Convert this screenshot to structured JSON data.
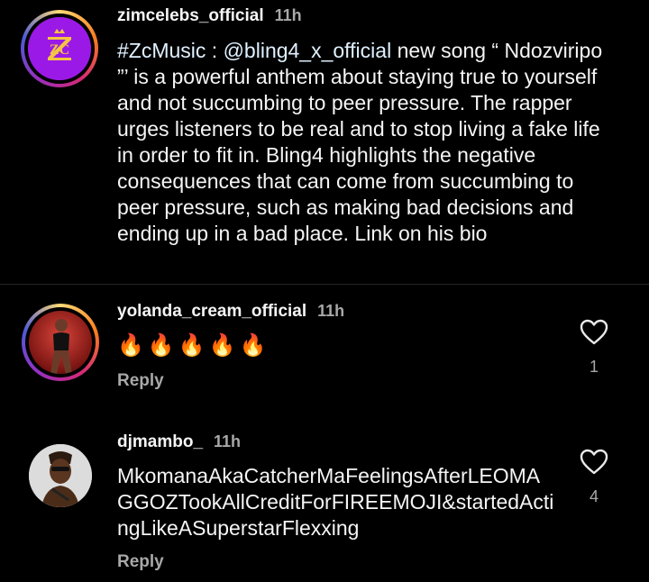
{
  "comments": [
    {
      "username": "zimcelebs_official",
      "time": "11h",
      "hashtag": "#ZcMusic",
      "sep": " : ",
      "mention": "@bling4_x_official",
      "text": " new song “ Ndozviripo ”’ is a powerful anthem about staying true to yourself and not succumbing to peer pressure. The rapper urges listeners to be real and to stop living a fake life in order to fit in. Bling4 highlights the negative consequences that can come from succumbing to peer pressure, such as making bad decisions and ending up in a bad place. Link on his bio",
      "avatar_logo": "ZC"
    },
    {
      "username": "yolanda_cream_official",
      "time": "11h",
      "text": "🔥🔥🔥🔥🔥",
      "reply_label": "Reply",
      "like_count": "1"
    },
    {
      "username": "djmambo_",
      "time": "11h",
      "text": "MkomanaAkaCatcherMaFeelingsAfterLEOMAGGOZTookAllCreditForFIREEMOJI&startedActingLikeASuperstarFlexxing",
      "reply_label": "Reply",
      "like_count": "4"
    }
  ],
  "colors": {
    "background": "#000000",
    "text": "#f5f5f5",
    "muted": "#a8a8a8",
    "link": "#e0f1ff",
    "zc_purple": "#9b19e6"
  },
  "icons": {
    "like": "heart-outline-icon"
  }
}
